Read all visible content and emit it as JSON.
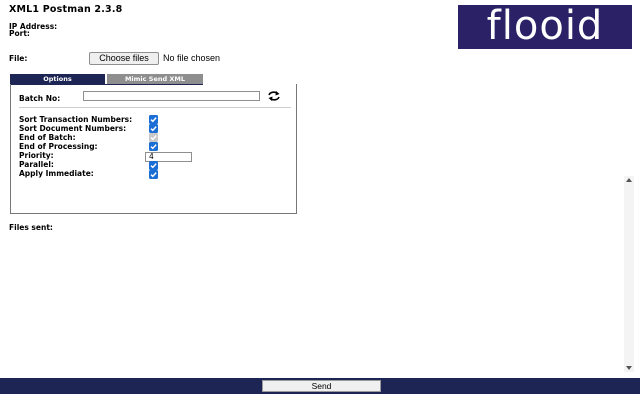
{
  "app": {
    "title": "XML1 Postman 2.3.8"
  },
  "connection": {
    "ip_label": "IP Address:",
    "port_label": "Port:"
  },
  "logo": {
    "text": "flooid",
    "background": "#2b2167"
  },
  "file": {
    "label": "File:",
    "button": "Choose files",
    "status": "No file chosen"
  },
  "tabs": [
    {
      "label": "Options",
      "active": true
    },
    {
      "label": "Mimic Send XML",
      "active": false
    }
  ],
  "options": {
    "batch_label": "Batch No:",
    "batch_value": "",
    "refresh_icon": "refresh-arrows-icon",
    "items": [
      {
        "label": "Sort Transaction Numbers:",
        "checked": true,
        "disabled": false
      },
      {
        "label": "Sort Document Numbers:",
        "checked": true,
        "disabled": false
      },
      {
        "label": "End of Batch:",
        "checked": true,
        "disabled": true
      },
      {
        "label": "End of Processing:",
        "checked": true,
        "disabled": false
      },
      {
        "label": "Priority:",
        "value": "4"
      },
      {
        "label": "Parallel:",
        "checked": true,
        "disabled": false
      },
      {
        "label": "Apply Immediate:",
        "checked": true,
        "disabled": false
      }
    ]
  },
  "files_sent": {
    "label": "Files sent:"
  },
  "footer": {
    "send_label": "Send",
    "bar_color": "#1c2553"
  }
}
